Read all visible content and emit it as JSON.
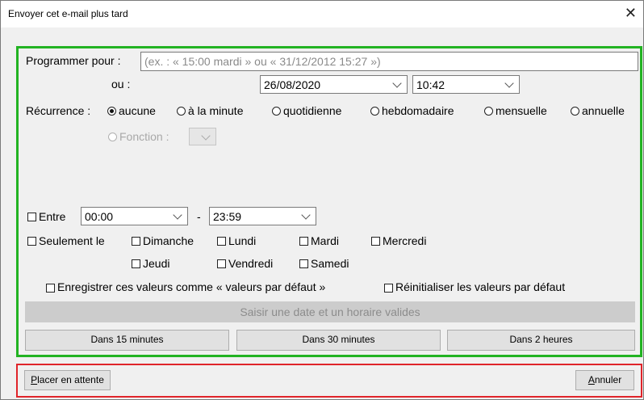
{
  "window": {
    "title": "Envoyer cet e-mail plus tard",
    "close_glyph": "✕"
  },
  "schedule": {
    "label": "Programmer pour :",
    "placeholder": "(ex. : « 15:00 mardi » ou « 31/12/2012 15:27 »)",
    "or_label": "ou :",
    "date_value": "26/08/2020",
    "time_value": "10:42"
  },
  "recurrence": {
    "label": "Récurrence :",
    "options": [
      "aucune",
      "à la minute",
      "quotidienne",
      "hebdomadaire",
      "mensuelle",
      "annuelle"
    ],
    "selected": "aucune",
    "function_label": "Fonction :"
  },
  "between": {
    "label": "Entre",
    "start": "00:00",
    "separator": "-",
    "end": "23:59"
  },
  "days": {
    "only_label": "Seulement le",
    "row1": [
      "Dimanche",
      "Lundi",
      "Mardi",
      "Mercredi"
    ],
    "row2": [
      "Jeudi",
      "Vendredi",
      "Samedi"
    ]
  },
  "defaults": {
    "save_label": "Enregistrer ces valeurs comme « valeurs par défaut »",
    "reset_label": "Réinitialiser les valeurs par défaut"
  },
  "main_button": "Saisir une date et un horaire valides",
  "quick_buttons": [
    "Dans 15 minutes",
    "Dans 30 minutes",
    "Dans 2 heures"
  ],
  "footer": {
    "hold_first": "P",
    "hold_rest": "lacer en attente",
    "cancel_first": "A",
    "cancel_rest": "nnuler"
  },
  "colors": {
    "highlight_green": "#22b322",
    "highlight_red": "#e0242a"
  }
}
